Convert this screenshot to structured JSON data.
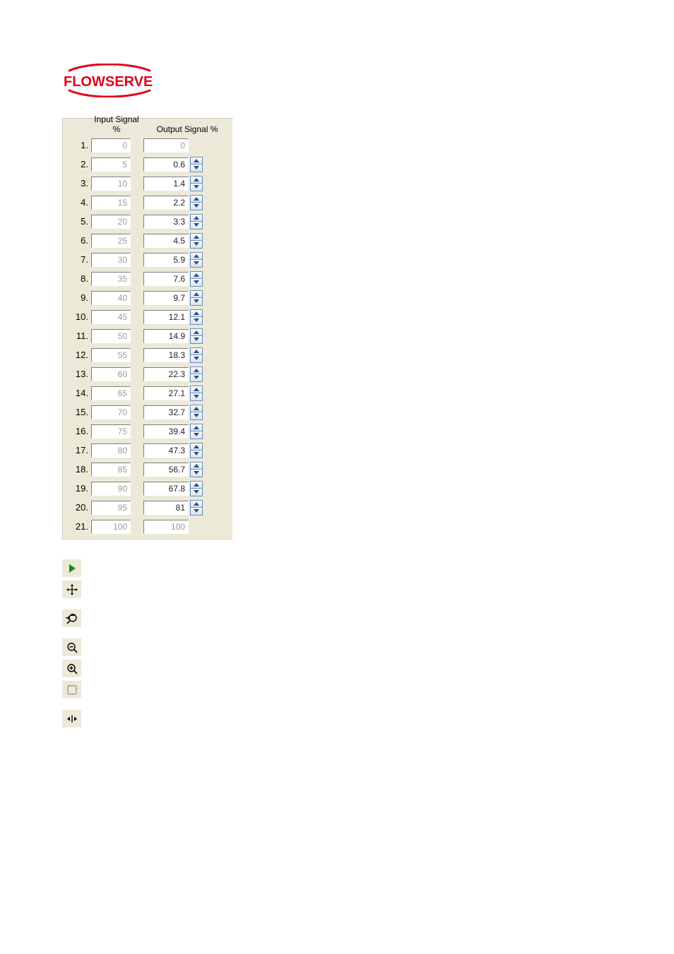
{
  "brand": {
    "name": "FLOWSERVE",
    "color": "#e3001b"
  },
  "table": {
    "header_input": "Input Signal %",
    "header_output": "Output Signal %",
    "rows": [
      {
        "n": "1.",
        "input": "0",
        "output": "0",
        "output_editable": false
      },
      {
        "n": "2.",
        "input": "5",
        "output": "0.6",
        "output_editable": true
      },
      {
        "n": "3.",
        "input": "10",
        "output": "1.4",
        "output_editable": true
      },
      {
        "n": "4.",
        "input": "15",
        "output": "2.2",
        "output_editable": true
      },
      {
        "n": "5.",
        "input": "20",
        "output": "3.3",
        "output_editable": true
      },
      {
        "n": "6.",
        "input": "25",
        "output": "4.5",
        "output_editable": true
      },
      {
        "n": "7.",
        "input": "30",
        "output": "5.9",
        "output_editable": true
      },
      {
        "n": "8.",
        "input": "35",
        "output": "7.6",
        "output_editable": true
      },
      {
        "n": "9.",
        "input": "40",
        "output": "9.7",
        "output_editable": true
      },
      {
        "n": "10.",
        "input": "45",
        "output": "12.1",
        "output_editable": true
      },
      {
        "n": "11.",
        "input": "50",
        "output": "14.9",
        "output_editable": true
      },
      {
        "n": "12.",
        "input": "55",
        "output": "18.3",
        "output_editable": true
      },
      {
        "n": "13.",
        "input": "60",
        "output": "22.3",
        "output_editable": true
      },
      {
        "n": "14.",
        "input": "65",
        "output": "27.1",
        "output_editable": true
      },
      {
        "n": "15.",
        "input": "70",
        "output": "32.7",
        "output_editable": true
      },
      {
        "n": "16.",
        "input": "75",
        "output": "39.4",
        "output_editable": true
      },
      {
        "n": "17.",
        "input": "80",
        "output": "47.3",
        "output_editable": true
      },
      {
        "n": "18.",
        "input": "85",
        "output": "56.7",
        "output_editable": true
      },
      {
        "n": "19.",
        "input": "90",
        "output": "67.8",
        "output_editable": true
      },
      {
        "n": "20.",
        "input": "95",
        "output": "81",
        "output_editable": true
      },
      {
        "n": "21.",
        "input": "100",
        "output": "100",
        "output_editable": false
      }
    ]
  },
  "chart_data": {
    "type": "table",
    "title": "Input vs Output Signal %",
    "xlabel": "Input Signal %",
    "ylabel": "Output Signal %",
    "x": [
      0,
      5,
      10,
      15,
      20,
      25,
      30,
      35,
      40,
      45,
      50,
      55,
      60,
      65,
      70,
      75,
      80,
      85,
      90,
      95,
      100
    ],
    "y": [
      0,
      0.6,
      1.4,
      2.2,
      3.3,
      4.5,
      5.9,
      7.6,
      9.7,
      12.1,
      14.9,
      18.3,
      22.3,
      27.1,
      32.7,
      39.4,
      47.3,
      56.7,
      67.8,
      81,
      100
    ],
    "xlim": [
      0,
      100
    ],
    "ylim": [
      0,
      100
    ]
  },
  "toolbar": {
    "items": [
      {
        "name": "play-icon",
        "type": "play"
      },
      {
        "name": "move-icon",
        "type": "move",
        "gap_after": true
      },
      {
        "name": "zoom-reset-icon",
        "type": "zoomreset",
        "gap_after": true
      },
      {
        "name": "zoom-out-icon",
        "type": "zoomout"
      },
      {
        "name": "zoom-in-icon",
        "type": "zoomin"
      },
      {
        "name": "zoom-region-icon",
        "type": "region",
        "gap_after": true
      },
      {
        "name": "fit-width-icon",
        "type": "fitw"
      }
    ]
  }
}
